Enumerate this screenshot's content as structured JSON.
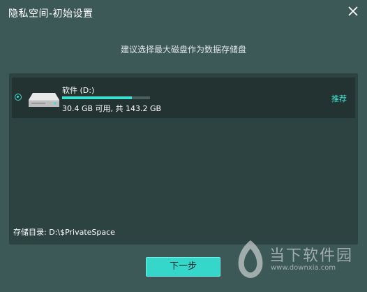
{
  "window": {
    "title": "隐私空间-初始设置"
  },
  "subtitle": "建议选择最大磁盘作为数据存储盘",
  "drive": {
    "name": "软件 (D:)",
    "free_gb": 30.4,
    "total_gb": 143.2,
    "info": "30.4 GB 可用, 共 143.2 GB",
    "used_fraction": 0.79,
    "recommend_label": "推荐",
    "selected": true
  },
  "storage": {
    "label": "存储目录: D:\\$PrivateSpace"
  },
  "buttons": {
    "next": "下一步"
  },
  "watermark": {
    "text": "当下软件园",
    "url": "www.downxia.com"
  },
  "colors": {
    "accent": "#3ce0d0",
    "background": "#3c5857",
    "panel": "#2d4342"
  },
  "icons": {
    "close": "close-icon",
    "drive": "hard-drive-icon",
    "radio": "radio-selected-icon"
  }
}
